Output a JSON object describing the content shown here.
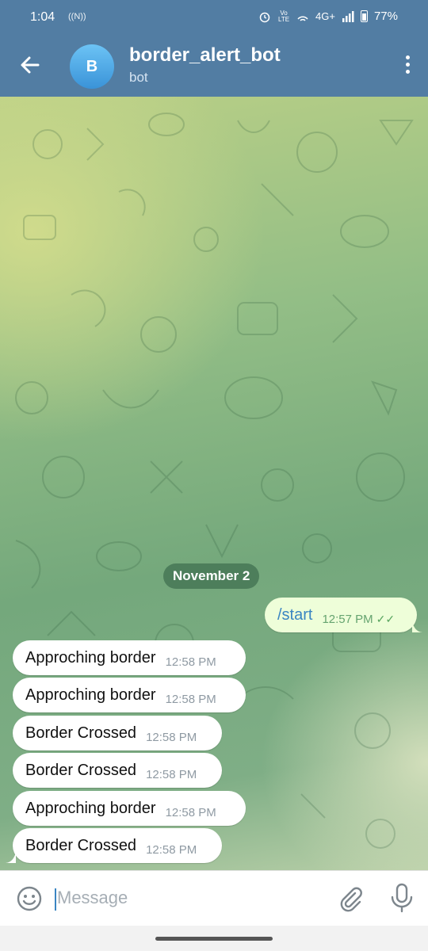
{
  "status_bar": {
    "time": "1:04",
    "nfc": "((N))",
    "network": "4G+",
    "volte": "Vo LTE",
    "battery": "77%"
  },
  "header": {
    "avatar_letter": "B",
    "title": "border_alert_bot",
    "subtitle": "bot"
  },
  "chat": {
    "date_label": "November 2",
    "outgoing": {
      "text": "/start",
      "time": "12:57 PM",
      "status": "read"
    },
    "incoming": [
      {
        "text": "Approching border",
        "time": "12:58 PM"
      },
      {
        "text": "Approching border",
        "time": "12:58 PM"
      },
      {
        "text": "Border Crossed",
        "time": "12:58 PM"
      },
      {
        "text": "Border Crossed",
        "time": "12:58 PM"
      },
      {
        "text": "Approching border",
        "time": "12:58 PM"
      },
      {
        "text": "Border Crossed",
        "time": "12:58 PM"
      }
    ]
  },
  "composer": {
    "placeholder": "Message"
  },
  "icons": [
    "back-arrow-icon",
    "kebab-menu-icon",
    "emoji-icon",
    "attach-icon",
    "microphone-icon",
    "double-check-icon"
  ],
  "colors": {
    "header": "#527da3",
    "outgoing_bubble": "#eefed9",
    "accent": "#3a85c2"
  }
}
